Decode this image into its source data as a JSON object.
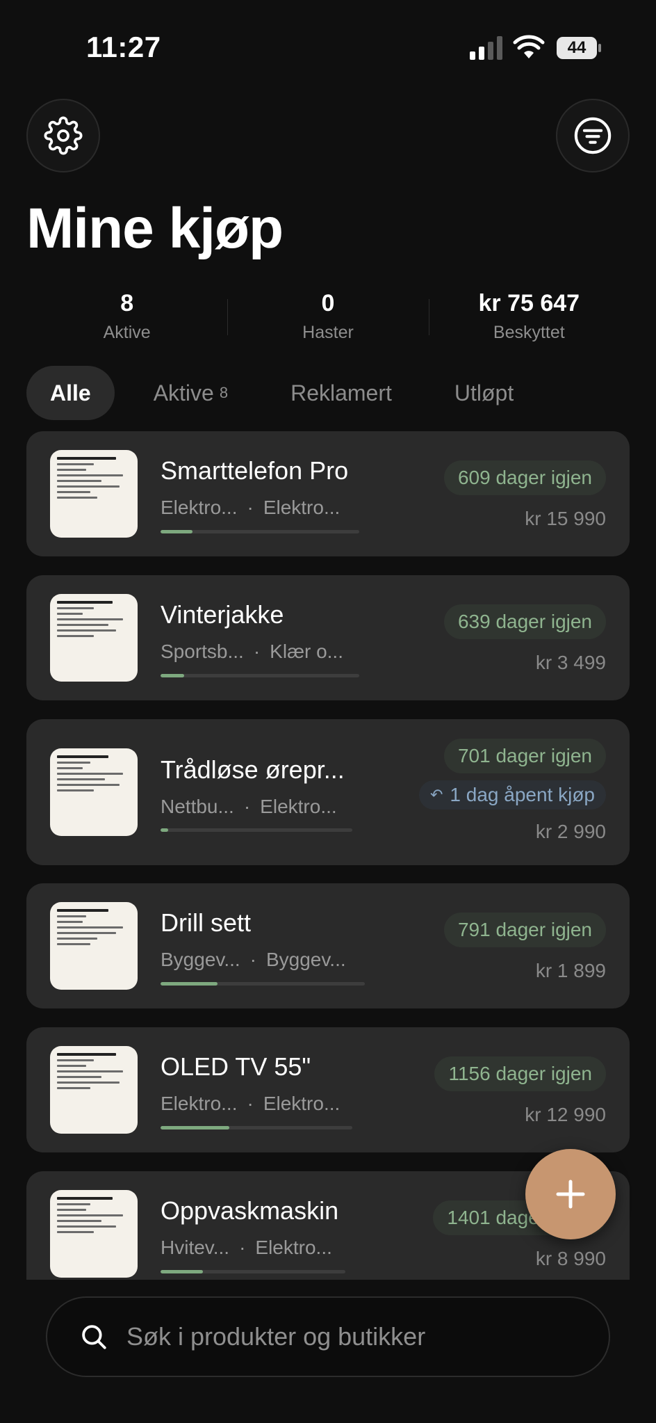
{
  "status": {
    "time": "11:27",
    "battery": "44"
  },
  "header": {
    "title": "Mine kjøp"
  },
  "stats": [
    {
      "value": "8",
      "label": "Aktive"
    },
    {
      "value": "0",
      "label": "Haster"
    },
    {
      "value": "kr 75 647",
      "label": "Beskyttet"
    }
  ],
  "tabs": [
    {
      "label": "Alle",
      "badge": ""
    },
    {
      "label": "Aktive",
      "badge": "8"
    },
    {
      "label": "Reklamert",
      "badge": ""
    },
    {
      "label": "Utløpt",
      "badge": ""
    }
  ],
  "purchases": [
    {
      "name": "Smarttelefon Pro",
      "store": "Elektro...",
      "category": "Elektro...",
      "days_left": "609 dager igjen",
      "price": "kr 15 990",
      "progress": 0.16,
      "open_purchase": ""
    },
    {
      "name": "Vinterjakke",
      "store": "Sportsb...",
      "category": "Klær o...",
      "days_left": "639 dager igjen",
      "price": "kr 3 499",
      "progress": 0.12,
      "open_purchase": ""
    },
    {
      "name": "Trådløse ørepr...",
      "store": "Nettbu...",
      "category": "Elektro...",
      "days_left": "701 dager igjen",
      "price": "kr 2 990",
      "progress": 0.04,
      "open_purchase": "1 dag åpent kjøp"
    },
    {
      "name": "Drill sett",
      "store": "Byggev...",
      "category": "Byggev...",
      "days_left": "791 dager igjen",
      "price": "kr 1 899",
      "progress": 0.28,
      "open_purchase": ""
    },
    {
      "name": "OLED TV 55\"",
      "store": "Elektro...",
      "category": "Elektro...",
      "days_left": "1156 dager igjen",
      "price": "kr 12 990",
      "progress": 0.36,
      "open_purchase": ""
    },
    {
      "name": "Oppvaskmaskin",
      "store": "Hvitev...",
      "category": "Elektro...",
      "days_left": "1401 dager igjen",
      "price": "kr 8 990",
      "progress": 0.23,
      "open_purchase": ""
    }
  ],
  "search": {
    "placeholder": "Søk i produkter og butikker"
  },
  "colors": {
    "accent": "#c79670",
    "progress": "#7ea97f",
    "pill_green": "#8fb48f",
    "pill_blue": "#8aa7c4"
  }
}
